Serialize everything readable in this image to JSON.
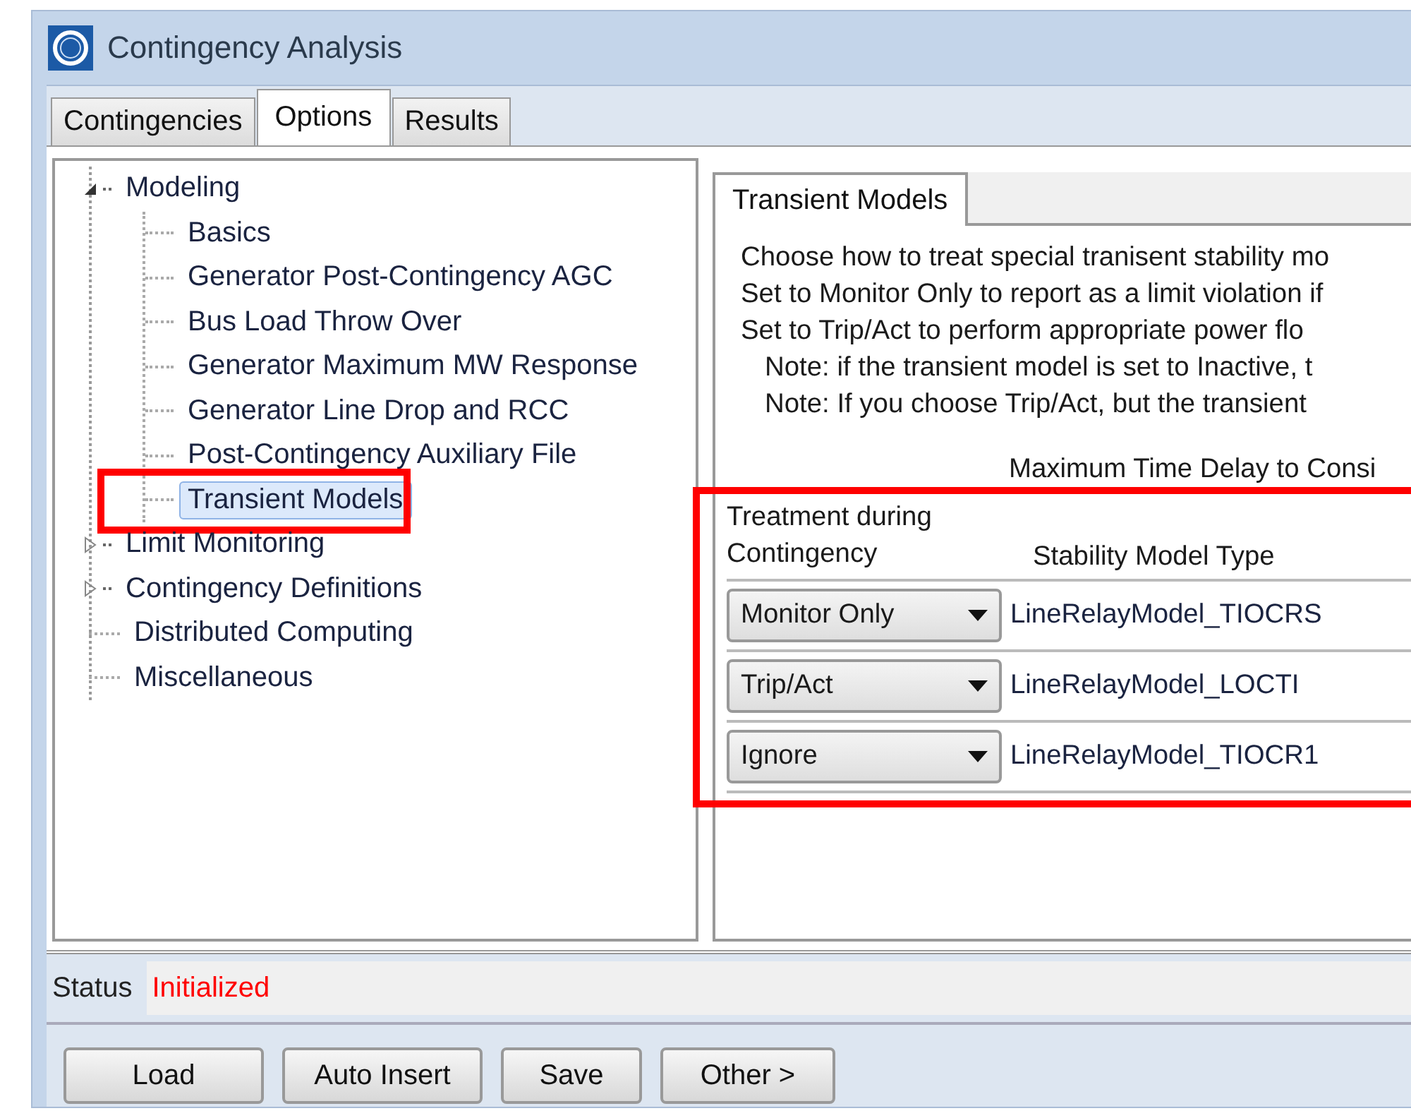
{
  "window": {
    "title": "Contingency Analysis"
  },
  "tabs": [
    {
      "label": "Contingencies",
      "selected": false
    },
    {
      "label": "Options",
      "selected": true
    },
    {
      "label": "Results",
      "selected": false
    }
  ],
  "tree": [
    {
      "label": "Modeling",
      "expanded": true,
      "selected": false,
      "children": [
        {
          "label": "Basics",
          "selected": false
        },
        {
          "label": "Generator Post-Contingency AGC",
          "selected": false
        },
        {
          "label": "Bus Load Throw Over",
          "selected": false
        },
        {
          "label": "Generator Maximum MW Response",
          "selected": false
        },
        {
          "label": "Generator Line Drop and RCC",
          "selected": false
        },
        {
          "label": "Post-Contingency Auxiliary File",
          "selected": false
        },
        {
          "label": "Transient Models",
          "selected": true,
          "highlighted": true
        }
      ]
    },
    {
      "label": "Limit Monitoring",
      "expanded": false,
      "selected": false
    },
    {
      "label": "Contingency Definitions",
      "expanded": false,
      "selected": false
    },
    {
      "label": "Distributed Computing",
      "selected": false
    },
    {
      "label": "Miscellaneous",
      "selected": false
    }
  ],
  "panel": {
    "tabs": [
      {
        "label": "Transient Models",
        "selected": true
      }
    ],
    "description": [
      "Choose how to treat special tranisent stability mo",
      "Set to Monitor Only to report as a limit violation if",
      "Set to Trip/Act to perform appropriate power flo"
    ],
    "notes": [
      "Note: if the transient model is set to Inactive, t",
      "Note: If you choose Trip/Act, but the transient"
    ],
    "delay_label": "Maximum Time Delay to Consi",
    "table": {
      "highlighted": true,
      "columns": [
        "Treatment during Contingency",
        "Stability Model Type"
      ],
      "rows": [
        {
          "treatment": "Monitor Only",
          "model_type": "LineRelayModel_TIOCRS"
        },
        {
          "treatment": "Trip/Act",
          "model_type": "LineRelayModel_LOCTI"
        },
        {
          "treatment": "Ignore",
          "model_type": "LineRelayModel_TIOCR1"
        }
      ]
    }
  },
  "status": {
    "label": "Status",
    "value": "Initialized"
  },
  "buttons": [
    "Load",
    "Auto Insert",
    "Save",
    "Other >"
  ]
}
